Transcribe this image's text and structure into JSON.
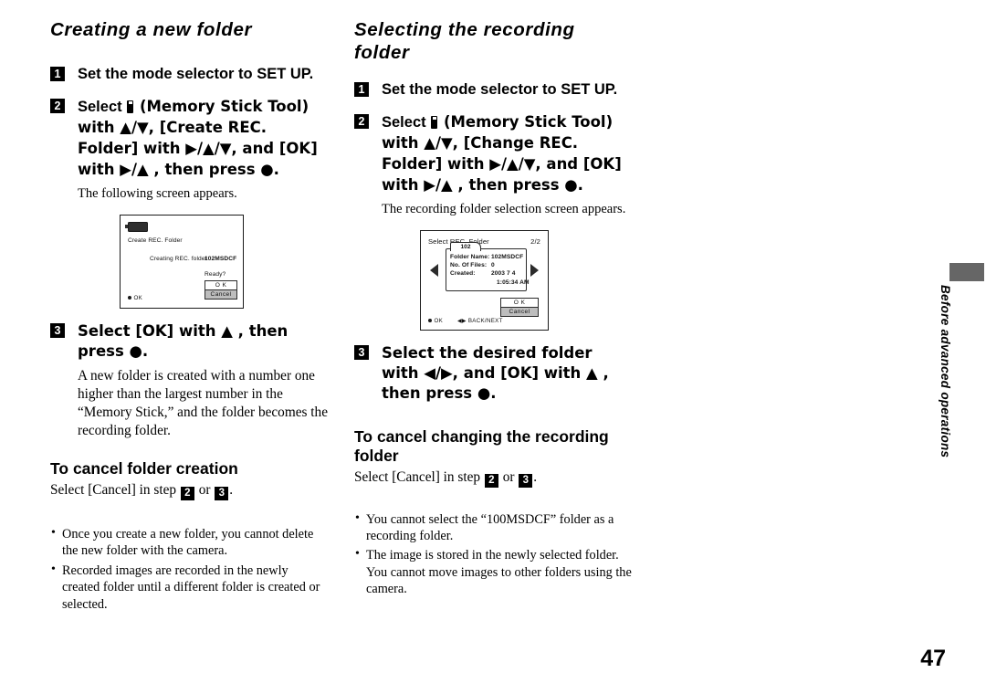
{
  "page": {
    "number": "47",
    "side_tab": "Before advanced operations"
  },
  "left_column": {
    "title": "Creating a new folder",
    "steps": [
      {
        "num": "1",
        "text_parts": [
          "Set the mode selector to SET UP."
        ]
      },
      {
        "num": "2",
        "prefix": "Select ",
        "icon": "memory-stick-icon",
        "text": " (Memory Stick Tool) with ▲/▼, [Create REC. Folder] with ▶/▲/▼, and [OK] with ▶/▲ , then press ●.",
        "note": "The following screen appears."
      },
      {
        "num": "3",
        "text": "Select [OK] with ▲ , then press ●.",
        "body": "A new folder is created with a number one higher than the largest number in the “Memory Stick,” and the folder becomes the recording folder."
      }
    ],
    "lcd": {
      "battery_icon": "battery-icon",
      "title": "Create REC. Folder",
      "message": "Creating REC. folder",
      "folder_name": "102MSDCF",
      "ready_label": "Ready?",
      "ok_label": "O K",
      "cancel_label": "Cancel",
      "footer_ok": "OK"
    },
    "cancel_heading": "To cancel folder creation",
    "cancel_text_pre": "Select [Cancel] in step ",
    "cancel_step_a": "2",
    "cancel_text_mid": " or ",
    "cancel_step_b": "3",
    "cancel_text_post": ".",
    "notes": [
      "Once you create a new folder, you cannot delete the new folder with the camera.",
      "Recorded images are recorded in the newly created folder until a different folder is created or selected."
    ]
  },
  "right_column": {
    "title": "Selecting the recording folder",
    "steps": [
      {
        "num": "1",
        "text": "Set the mode selector to SET UP."
      },
      {
        "num": "2",
        "prefix": "Select ",
        "icon": "memory-stick-icon",
        "text": " (Memory Stick Tool) with ▲/▼, [Change REC. Folder] with ▶/▲/▼, and [OK] with ▶/▲ , then press ●.",
        "note": "The recording folder selection screen appears."
      },
      {
        "num": "3",
        "text": "Select the desired folder with ◀/▶, and [OK] with ▲ , then press ●."
      }
    ],
    "lcd": {
      "title": "Select REC. Folder",
      "page_indicator": "2/2",
      "folder_tab": "102",
      "rows": [
        {
          "label": "Folder Name:",
          "value": "102MSDCF"
        },
        {
          "label": "No. Of Files:",
          "value": "0"
        },
        {
          "label": "Created:",
          "value": "2003  7  4"
        }
      ],
      "created_time": "1:05:34 AM",
      "ok_label": "O K",
      "cancel_label": "Cancel",
      "footer_ok": "OK",
      "footer_nav": "BACK/NEXT",
      "left_arrow_icon": "arrow-left-icon",
      "right_arrow_icon": "arrow-right-icon"
    },
    "cancel_heading": "To cancel changing the recording folder",
    "cancel_text_pre": "Select [Cancel] in step ",
    "cancel_step_a": "2",
    "cancel_text_mid": " or ",
    "cancel_step_b": "3",
    "cancel_text_post": ".",
    "notes": [
      "You cannot select the “100MSDCF” folder as a recording folder.",
      "The image is stored in the newly selected folder. You cannot move images to other folders using the camera."
    ]
  }
}
